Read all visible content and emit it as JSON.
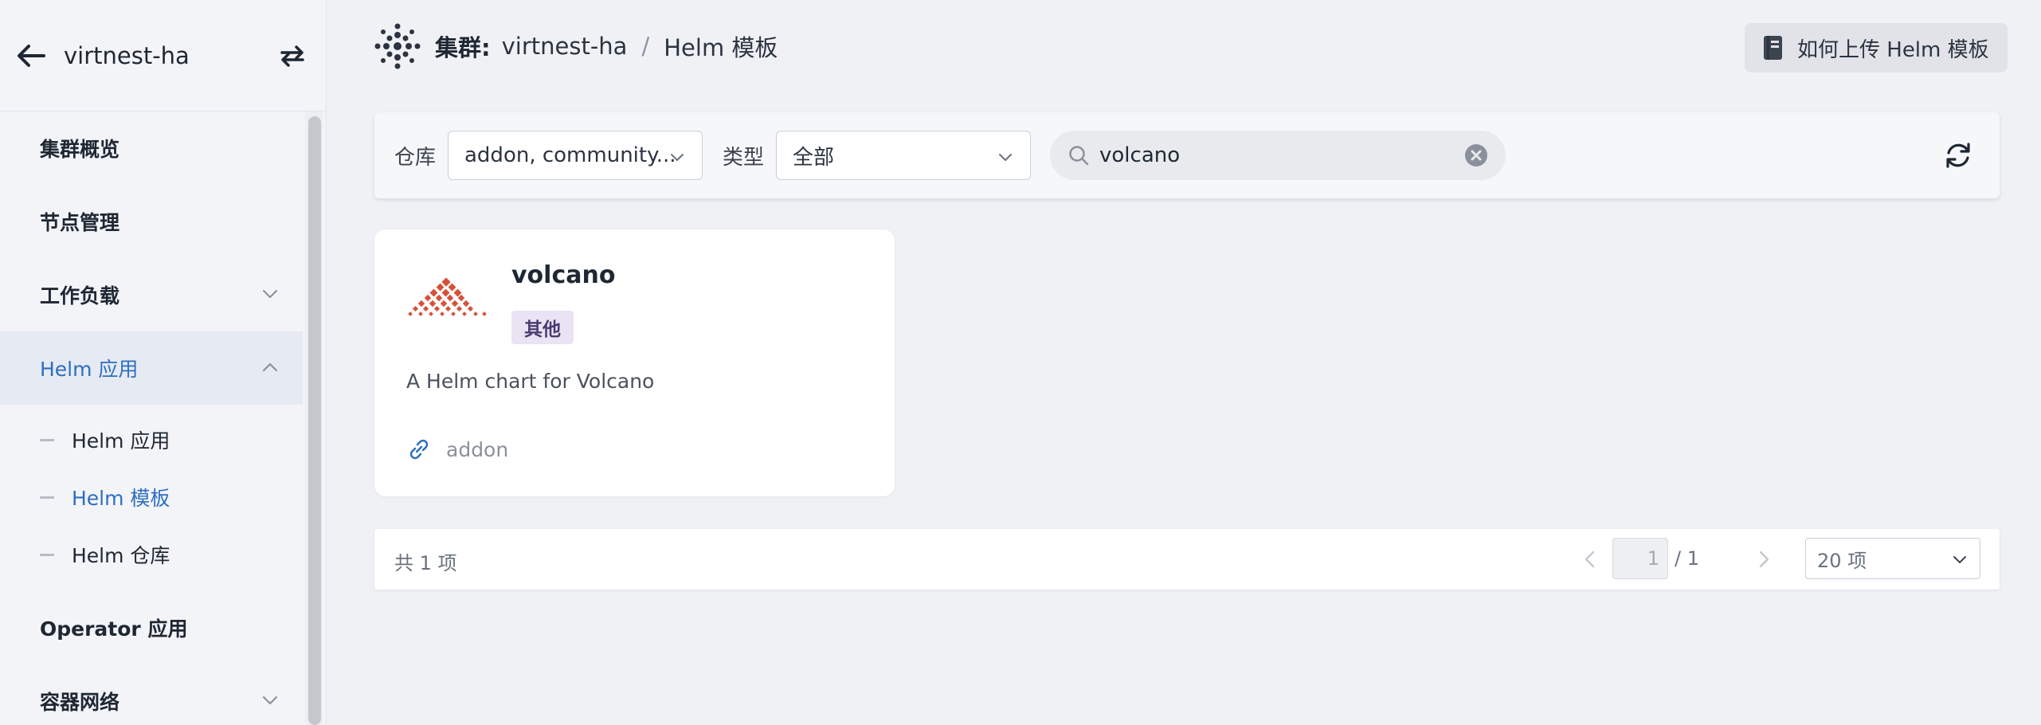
{
  "sidebar": {
    "title": "virtnest-ha",
    "menu": [
      {
        "label": "集群概览"
      },
      {
        "label": "节点管理"
      },
      {
        "label": "工作负载"
      },
      {
        "label": "Helm 应用"
      },
      {
        "label": "Operator 应用"
      },
      {
        "label": "容器网络"
      }
    ],
    "submenu": [
      {
        "label": "Helm 应用"
      },
      {
        "label": "Helm 模板"
      },
      {
        "label": "Helm 仓库"
      }
    ]
  },
  "header": {
    "cluster_label": "集群:",
    "cluster_name": "virtnest-ha",
    "separator": "/",
    "current_page": "Helm 模板",
    "help_button": "如何上传 Helm 模板"
  },
  "filters": {
    "repo_label": "仓库",
    "repo_value": "addon, community...",
    "type_label": "类型",
    "type_value": "全部",
    "search_value": "volcano"
  },
  "cards": [
    {
      "name": "volcano",
      "tag": "其他",
      "description": "A Helm chart for Volcano",
      "repo": "addon"
    }
  ],
  "pagination": {
    "total": "共 1 项",
    "page": "1",
    "of_pages": "/ 1",
    "page_size": "20 项"
  },
  "colors": {
    "accent": "#2d6fc0",
    "tag_bg": "#e9e4f4",
    "logo": "#d5523a"
  }
}
